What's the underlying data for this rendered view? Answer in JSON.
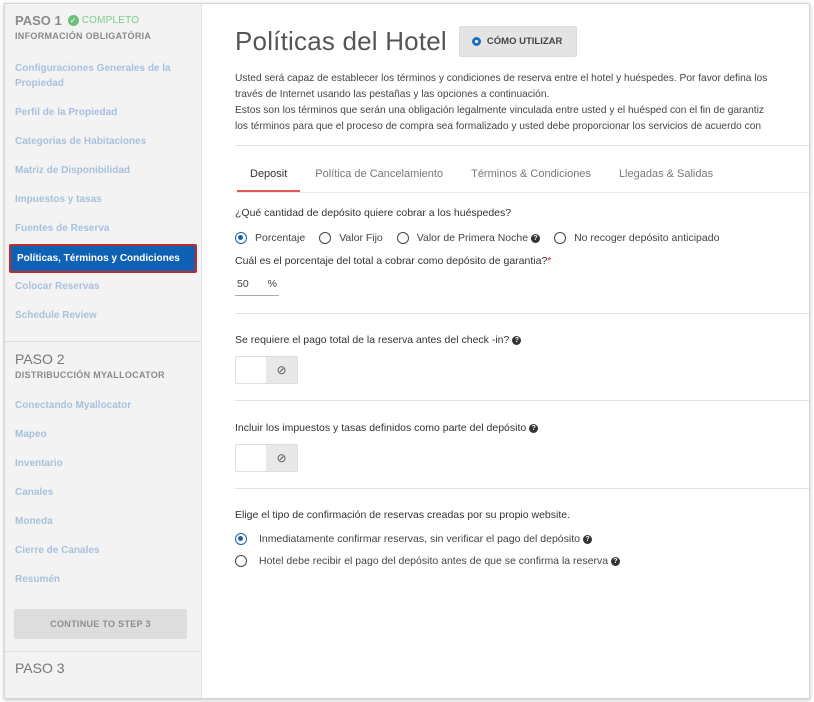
{
  "sidebar": {
    "step1": {
      "title": "PASO 1",
      "status": "COMPLETO",
      "subtitle": "INFORMACIÓN OBLIGATÓRIA"
    },
    "step1_items": [
      {
        "label": "Configuraciones Generales de la Propiedad"
      },
      {
        "label": "Perfil de la Propiedad"
      },
      {
        "label": "Categorias de Habitaciones"
      },
      {
        "label": "Matriz de Disponibilidad"
      },
      {
        "label": "Impuestos y tasas"
      },
      {
        "label": "Fuentes de Reserva"
      },
      {
        "label": "Políticas, Términos y Condiciones"
      },
      {
        "label": "Colocar Reservas"
      },
      {
        "label": "Schedule Review"
      }
    ],
    "step2": {
      "title": "PASO 2",
      "subtitle": "DISTRIBUCCIÓN MYALLOCATOR"
    },
    "step2_items": [
      {
        "label": "Conectando Myallocator"
      },
      {
        "label": "Mapeo"
      },
      {
        "label": "Inventario"
      },
      {
        "label": "Canales"
      },
      {
        "label": "Moneda"
      },
      {
        "label": "Cierre de Canales"
      },
      {
        "label": "Resumén"
      }
    ],
    "continue_label": "CONTINUE TO STEP 3",
    "step3": {
      "title": "PASO 3"
    }
  },
  "main": {
    "title": "Políticas del Hotel",
    "howto_label": "CÓMO UTILIZAR",
    "intro_lines": [
      "Usted será capaz de establecer los términos y condiciones de reserva entre el hotel y huéspedes. Por favor defina los",
      "través de Internet usando las pestañas y las opciones a continuación.",
      "Estos son los términos que serán una obligación legalmente vinculada entre usted y el huésped con el fin de garantiz",
      "los términos para que el proceso de compra sea formalizado y usted debe proporcionar los servicios de acuerdo con"
    ],
    "tabs": [
      {
        "label": "Deposit"
      },
      {
        "label": "Política de Cancelamiento"
      },
      {
        "label": "Términos & Condiciones"
      },
      {
        "label": "Llegadas & Salidas"
      }
    ],
    "deposit_question": "¿Qué cantidad de depósito quiere cobrar a los huéspedes?",
    "deposit_options": [
      {
        "label": "Porcentaje"
      },
      {
        "label": "Valor Fijo"
      },
      {
        "label": "Valor de Primera Noche"
      },
      {
        "label": "No recoger depósito anticipado"
      }
    ],
    "percent_question": "Cuál es el porcentaje del total a cobrar como depósito de garantia?",
    "required_mark": "*",
    "percent_value": "50",
    "percent_unit": "%",
    "full_payment_question": "Se requiere el pago total de la reserva antes del check -in?",
    "include_taxes_question": "Incluir los impuestos y tasas definidos como parte del depósito",
    "toggle_off_symbol": "⊘",
    "confirmation_question": "Elige el tipo de confirmación de reservas creadas por su propio website.",
    "confirmation_options": [
      {
        "label": "Inmediatamente confirmar reservas, sin verificar el pago del depósito"
      },
      {
        "label": "Hotel debe recibir el pago del depósito antes de que se confirma la reserva"
      }
    ],
    "help_symbol": "?"
  }
}
